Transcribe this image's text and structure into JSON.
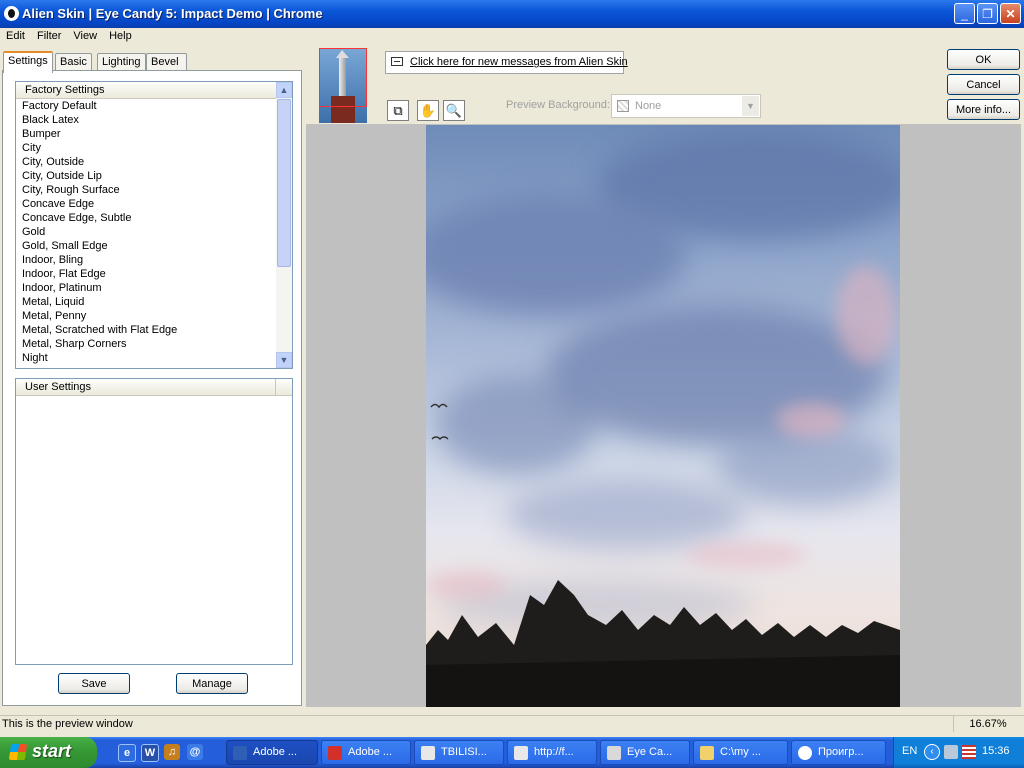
{
  "window": {
    "title": "Alien Skin | Eye Candy 5: Impact Demo | Chrome",
    "min_glyph": "_",
    "max_glyph": "❐",
    "close_glyph": "✕"
  },
  "menu": [
    "Edit",
    "Filter",
    "View",
    "Help"
  ],
  "tabs": [
    "Settings",
    "Basic",
    "Lighting",
    "Bevel Profile"
  ],
  "factory_settings": {
    "header": "Factory Settings",
    "items": [
      "Factory Default",
      "Black Latex",
      "Bumper",
      "City",
      "City, Outside",
      "City, Outside Lip",
      "City, Rough Surface",
      "Concave Edge",
      "Concave Edge, Subtle",
      "Gold",
      "Gold, Small Edge",
      "Indoor, Bling",
      "Indoor, Flat Edge",
      "Indoor, Platinum",
      "Metal, Liquid",
      "Metal, Penny",
      "Metal, Scratched with Flat Edge",
      "Metal, Sharp Corners",
      "Night"
    ]
  },
  "user_settings": {
    "header": "User Settings"
  },
  "buttons": {
    "save": "Save",
    "manage": "Manage",
    "ok": "OK",
    "cancel": "Cancel",
    "more_info": "More info..."
  },
  "messages_link": "Click here for new messages from Alien Skin",
  "preview_background": {
    "label": "Preview Background:",
    "value": "None"
  },
  "tool_icons": [
    "compare-icon",
    "hand-icon",
    "zoom-icon"
  ],
  "status": {
    "message": "This is the preview window",
    "zoom": "16.67%"
  },
  "taskbar": {
    "start": "start",
    "tasks": [
      {
        "label": "Adobe ...",
        "icon": "photoshop-icon"
      },
      {
        "label": "Adobe ...",
        "icon": "acrobat-icon"
      },
      {
        "label": "TBILISI...",
        "icon": "document-icon"
      },
      {
        "label": "http://f...",
        "icon": "browser-icon"
      },
      {
        "label": "Eye Ca...",
        "icon": "eyecandy-icon"
      },
      {
        "label": "C:\\my ...",
        "icon": "folder-icon"
      },
      {
        "label": "Проигр...",
        "icon": "media-player-icon"
      }
    ],
    "tray": {
      "language": "EN",
      "clock": "15:36"
    }
  }
}
